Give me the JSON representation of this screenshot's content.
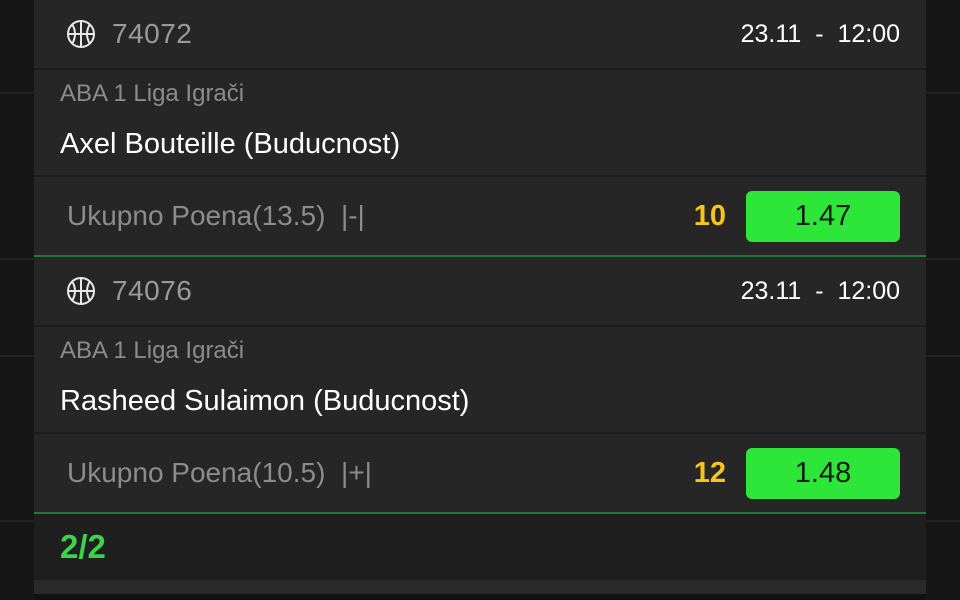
{
  "matches": [
    {
      "id": "74072",
      "datetime": "23.11  -  12:00",
      "league": "ABA 1 Liga Igrači",
      "player": "Axel Bouteille (Buducnost)",
      "market": "Ukupno Poena(13.5)  |-|",
      "pick_count": "10",
      "odd": "1.47"
    },
    {
      "id": "74076",
      "datetime": "23.11  -  12:00",
      "league": "ABA 1 Liga Igrači",
      "player": "Rasheed Sulaimon (Buducnost)",
      "market": "Ukupno Poena(10.5)  |+|",
      "pick_count": "12",
      "odd": "1.48"
    }
  ],
  "pager": {
    "label": "2/2"
  },
  "colors": {
    "odd_button": "#2ee63a",
    "pick_count": "#f5c518",
    "pager": "#3ed24a",
    "card_divider": "#1e7a32"
  },
  "icons": {
    "sport": "basketball-icon"
  }
}
